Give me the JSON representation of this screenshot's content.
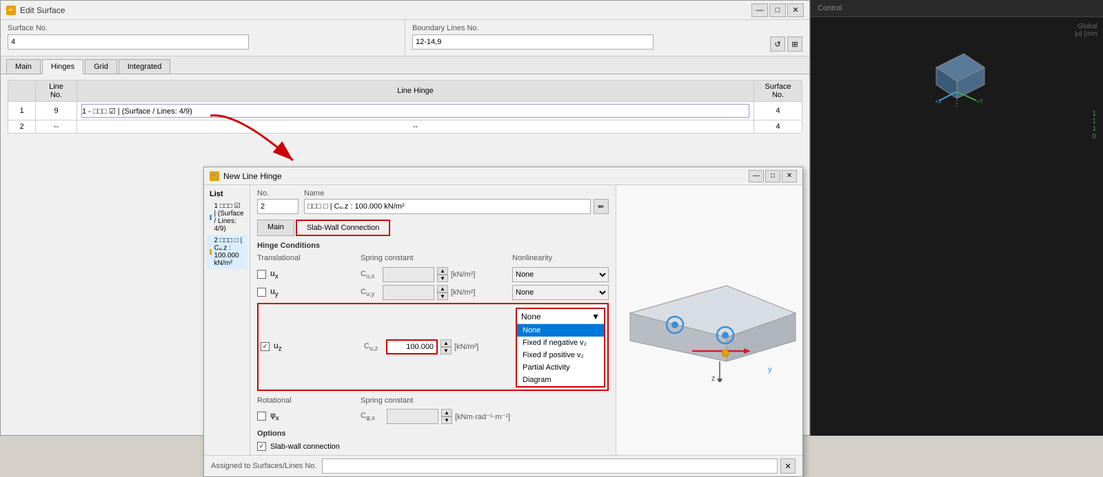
{
  "main_window": {
    "title": "Edit Surface",
    "surface_no_label": "Surface No.",
    "surface_no_value": "4",
    "boundary_lines_label": "Boundary Lines No.",
    "boundary_lines_value": "12-14,9",
    "tabs": [
      "Main",
      "Hinges",
      "Grid",
      "Integrated"
    ],
    "active_tab": "Hinges",
    "table": {
      "headers": [
        "Line No.",
        "Line Hinge",
        "Surface No."
      ],
      "rows": [
        {
          "row_no": "1",
          "line_no": "9",
          "hinge": "1 - □□□ ☑ | (Surface / Lines: 4/9)",
          "surface_no": "4"
        },
        {
          "row_no": "2",
          "line_no": "--",
          "hinge": "--",
          "surface_no": "4"
        }
      ]
    }
  },
  "dialog": {
    "title": "New Line Hinge",
    "list_label": "List",
    "list_items": [
      {
        "id": 1,
        "text": "1 □□□ ☑ | (Surface / Lines: 4/9)",
        "color": "#4a9ade"
      },
      {
        "id": 2,
        "text": "2 □□□ □ | Cᵤ.z : 100.000 kN/m²",
        "color": "#e8a000"
      }
    ],
    "no_label": "No.",
    "no_value": "2",
    "name_label": "Name",
    "name_value": "□□□ □ | Cᵤ.z : 100.000 kN/m²",
    "tabs": [
      "Main",
      "Slab-Wall Connection"
    ],
    "active_tab": "Slab-Wall Connection",
    "hinge_conditions_label": "Hinge Conditions",
    "translational_label": "Translational",
    "spring_constant_label": "Spring constant",
    "nonlinearity_label": "Nonlinearity",
    "ux_label": "uₓ",
    "uy_label": "uᵧ",
    "uz_label": "uᵤ",
    "cux_label": "Cᵤ.x",
    "cuy_label": "Cᵤ.y",
    "cuz_label": "Cᵤ.z",
    "cuz_value": "100.000",
    "unit_knm2": "[kN/m²]",
    "nonlinearity_options": [
      "None",
      "Fixed if negative v₂",
      "Fixed if positive v₂",
      "Partial Activity",
      "Diagram"
    ],
    "nonlinearity_ux": "None",
    "nonlinearity_uy": "None",
    "nonlinearity_uz_selected": "None",
    "rotational_label": "Rotational",
    "spring_constant_rot_label": "Spring constant",
    "phix_label": "φₓ",
    "cphix_label": "Cφ.x",
    "unit_knmradm": "[kNm·rad⁻¹·m⁻¹]",
    "options_label": "Options",
    "slab_wall_connection_label": "Slab-wall connection",
    "assigned_label": "Assigned to Surfaces/Lines No."
  },
  "icons": {
    "minimize": "—",
    "maximize": "□",
    "close": "✕",
    "edit": "✏",
    "arrow_up": "▲",
    "arrow_down": "▼",
    "refresh": "↺",
    "grid_icon": "⊞"
  },
  "colors": {
    "accent_red": "#cc0000",
    "accent_blue": "#0078d7",
    "selected_blue": "#dbeeff",
    "dropdown_highlight": "#0078d7",
    "list_item1": "#4a9ade",
    "list_item2": "#e8a000"
  }
}
